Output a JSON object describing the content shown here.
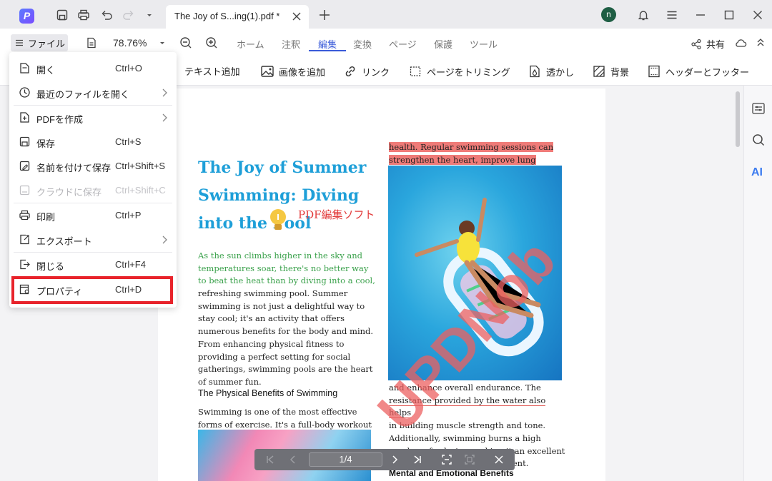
{
  "titlebar": {
    "tab_title": "The Joy of S...ing(1).pdf *",
    "avatar_letter": "n"
  },
  "menubar": {
    "file_label": "ファイル",
    "zoom": "78.76%",
    "tabs": [
      "ホーム",
      "注釈",
      "編集",
      "変換",
      "ページ",
      "保護",
      "ツール"
    ],
    "active_tab": "編集",
    "share_label": "共有"
  },
  "toolbar": {
    "items": [
      "テキスト追加",
      "画像を追加",
      "リンク",
      "ページをトリミング",
      "透かし",
      "背景",
      "ヘッダーとフッター"
    ]
  },
  "file_menu": {
    "items": [
      {
        "label": "開く",
        "shortcut": "Ctrl+O",
        "icon": "open-icon"
      },
      {
        "label": "最近のファイルを開く",
        "shortcut": "",
        "icon": "clock-icon",
        "submenu": true
      },
      {
        "label": "PDFを作成",
        "shortcut": "",
        "icon": "create-pdf-icon",
        "submenu": true
      },
      {
        "label": "保存",
        "shortcut": "Ctrl+S",
        "icon": "save-icon"
      },
      {
        "label": "名前を付けて保存",
        "shortcut": "Ctrl+Shift+S",
        "icon": "save-as-icon"
      },
      {
        "label": "クラウドに保存",
        "shortcut": "Ctrl+Shift+C",
        "icon": "cloud-save-icon",
        "disabled": true
      },
      {
        "label": "印刷",
        "shortcut": "Ctrl+P",
        "icon": "print-icon"
      },
      {
        "label": "エクスポート",
        "shortcut": "",
        "icon": "export-icon",
        "submenu": true
      },
      {
        "label": "閉じる",
        "shortcut": "Ctrl+F4",
        "icon": "close-file-icon"
      },
      {
        "label": "プロパティ",
        "shortcut": "Ctrl+D",
        "icon": "properties-icon"
      }
    ]
  },
  "document": {
    "title": "The Joy of Summer Swimming: Diving into the Pool",
    "annotation_label": "PDF編集ソフト",
    "intro_green": "As the sun climbs higher in the sky and temperatures soar, there's no better way to beat the heat than by diving into a cool,",
    "intro_rest": "refreshing swimming pool. Summer swimming is not just a delightful way to stay cool; it's an activity that offers numerous benefits for the body and mind. From enhancing physical fitness to providing a perfect setting for social gatherings, swimming pools are the heart of summer fun.",
    "section_heading": "The Physical Benefits of Swimming",
    "section_text": "Swimming is one of the most effective forms of exercise. It's a full-body workout that",
    "right_highlight_1": "health. Regular swimming sessions can",
    "right_highlight_2": "strengthen the heart, improve lung capacity,",
    "right_after_1": "and enhance overall endurance. The",
    "right_after_2": "resistance provided by the water also helps",
    "right_after_3": "in building muscle strength and tone. Additionally, swimming burns a high number of calories, making it an excellent exercise for weight management.",
    "watermark": "UPDNob",
    "bottom_heading": "Mental and Emotional Benefits"
  },
  "pager": {
    "page_indicator": "1/4"
  },
  "colors": {
    "accent": "#3a5bd9",
    "title_blue": "#1e9fd8",
    "green_text": "#3aa14b",
    "highlight_red": "#ef7b78",
    "callout_red": "#e8232b"
  }
}
